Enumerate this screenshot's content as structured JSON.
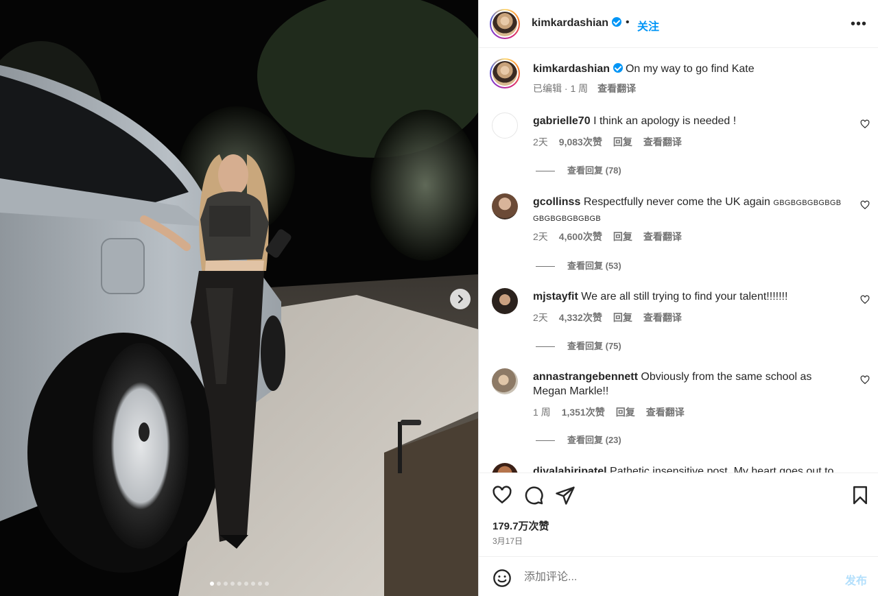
{
  "post": {
    "carousel_count": 9,
    "carousel_active": 0,
    "next_icon": "chevron-right-icon"
  },
  "header": {
    "username": "kimkardashian",
    "separator": "•",
    "follow_label": "关注",
    "more_icon": "more-horizontal-icon"
  },
  "caption": {
    "username": "kimkardashian",
    "text": "On my way to go find Kate",
    "edited": "已编辑 · 1 周",
    "translate": "查看翻译"
  },
  "comments": [
    {
      "username": "gabrielle70",
      "text": "I think an apology is needed !",
      "extra": "",
      "time": "2天",
      "likes": "9,083次赞",
      "reply": "回复",
      "translate": "查看翻译",
      "replies": "查看回复 (78)"
    },
    {
      "username": "gcollinss",
      "text": "Respectfully never come the UK again",
      "extra": "GBGBGBGBGBGB GBGBGBGBGBGB",
      "time": "2天",
      "likes": "4,600次赞",
      "reply": "回复",
      "translate": "查看翻译",
      "replies": "查看回复 (53)"
    },
    {
      "username": "mjstayfit",
      "text": "We are all still trying to find your talent!!!!!!!",
      "extra": "",
      "time": "2天",
      "likes": "4,332次赞",
      "reply": "回复",
      "translate": "查看翻译",
      "replies": "查看回复 (75)"
    },
    {
      "username": "annastrangebennett",
      "text": "Obviously from the same school as Megan Markle!!",
      "extra": "",
      "time": "1 周",
      "likes": "1,351次赞",
      "reply": "回复",
      "translate": "查看翻译",
      "replies": "查看回复 (23)"
    },
    {
      "username": "divalahiripatel",
      "text": "Pathetic insensitive post. My heart goes out to",
      "extra": "",
      "time": "",
      "likes": "",
      "reply": "",
      "translate": "",
      "replies": ""
    }
  ],
  "actions": {
    "like_icon": "heart-icon",
    "comment_icon": "comment-icon",
    "share_icon": "send-icon",
    "save_icon": "bookmark-icon",
    "likes_count": "179.7万次赞",
    "date": "3月17日"
  },
  "composer": {
    "placeholder": "添加评论...",
    "post_label": "发布",
    "emoji_icon": "emoji-icon"
  },
  "colors": {
    "link_blue": "#0095f6",
    "secondary_text": "#737373",
    "post_disabled": "#b2dffc"
  }
}
